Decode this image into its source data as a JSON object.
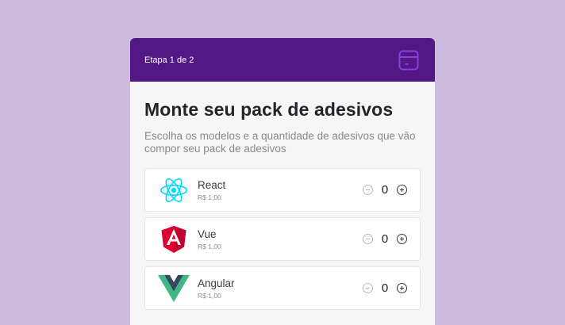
{
  "header": {
    "step_label": "Etapa 1 de 2",
    "icon": "box-icon"
  },
  "main": {
    "title": "Monte seu pack de adesivos",
    "subtitle": "Escolha os modelos e a quantidade de adesivos que vão compor seu pack de adesivos"
  },
  "stickers": [
    {
      "name": "React",
      "price": "R$ 1,00",
      "quantity": "0",
      "icon": "react-logo-icon"
    },
    {
      "name": "Vue",
      "price": "R$ 1,00",
      "quantity": "0",
      "icon": "angular-logo-icon"
    },
    {
      "name": "Angular",
      "price": "R$ 1,00",
      "quantity": "0",
      "icon": "vue-logo-icon"
    }
  ],
  "colors": {
    "header": "#521886",
    "accent": "#8c3de0",
    "background": "#cbbbdc"
  }
}
